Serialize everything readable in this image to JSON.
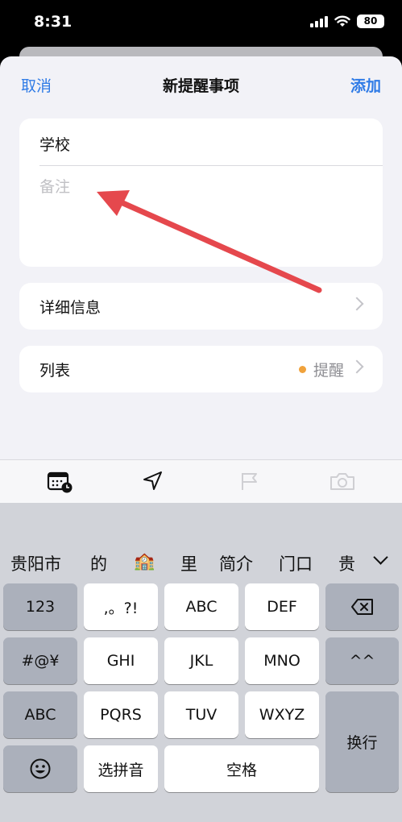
{
  "status_bar": {
    "time": "8:31",
    "battery": "80"
  },
  "nav": {
    "cancel": "取消",
    "title": "新提醒事项",
    "add": "添加"
  },
  "form": {
    "title_value": "学校",
    "notes_placeholder": "备注",
    "details_label": "详细信息",
    "list_label": "列表",
    "list_value": "提醒",
    "list_dot_color": "#f0a23c"
  },
  "annotation": {
    "arrow_color": "#e5484d"
  },
  "toolbar": {
    "icons": [
      "calendar-clock-icon",
      "location-arrow-icon",
      "flag-icon",
      "camera-icon"
    ]
  },
  "keyboard": {
    "candidates": [
      "贵阳市",
      "的",
      "🏫",
      "里",
      "简介",
      "门口",
      "贵"
    ],
    "keys": {
      "k123": "123",
      "punct": ",。?!",
      "abc": "ABC",
      "def": "DEF",
      "symbols": "#@¥",
      "ghi": "GHI",
      "jkl": "JKL",
      "mno": "MNO",
      "caret": "^^",
      "abc_switch": "ABC",
      "pqrs": "PQRS",
      "tuv": "TUV",
      "wxyz": "WXYZ",
      "return": "换行",
      "pinyin": "选拼音",
      "space": "空格"
    }
  }
}
